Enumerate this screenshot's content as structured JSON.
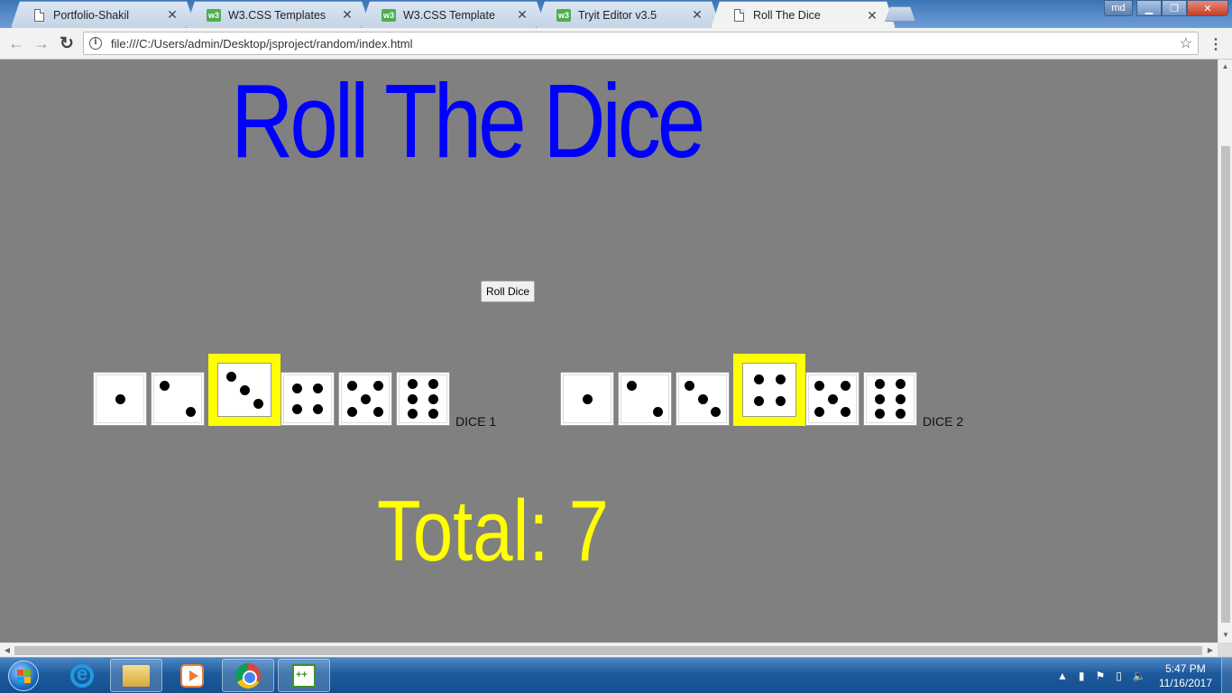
{
  "browser": {
    "tabs": [
      {
        "title": "Portfolio-Shakil",
        "icon": "page-icon",
        "active": false
      },
      {
        "title": "W3.CSS Templates",
        "icon": "w3schools-icon",
        "active": false
      },
      {
        "title": "W3.CSS Template",
        "icon": "w3schools-icon",
        "active": false
      },
      {
        "title": "Tryit Editor v3.5",
        "icon": "w3schools-icon",
        "active": false
      },
      {
        "title": "Roll The Dice",
        "icon": "page-icon",
        "active": true
      }
    ],
    "close_glyph": "✕",
    "url": "file:///C:/Users/admin/Desktop/jsproject/random/index.html",
    "profile_label": "md"
  },
  "page": {
    "heading": "Roll The Dice",
    "roll_button_label": "Roll Dice",
    "dice_groups": [
      {
        "label": "DICE 1",
        "faces": [
          1,
          2,
          3,
          4,
          5,
          6
        ],
        "selected": 3
      },
      {
        "label": "DICE 2",
        "faces": [
          1,
          2,
          3,
          4,
          5,
          6
        ],
        "selected": 4
      }
    ],
    "total_text": "Total: 7",
    "heading_color": "#0000ff",
    "highlight_color": "#ffff00",
    "background_color": "#808080"
  },
  "taskbar": {
    "apps": [
      "internet-explorer-icon",
      "file-explorer-icon",
      "media-player-icon",
      "chrome-icon",
      "editor-icon"
    ],
    "time": "5:47 PM",
    "date": "11/16/2017"
  }
}
